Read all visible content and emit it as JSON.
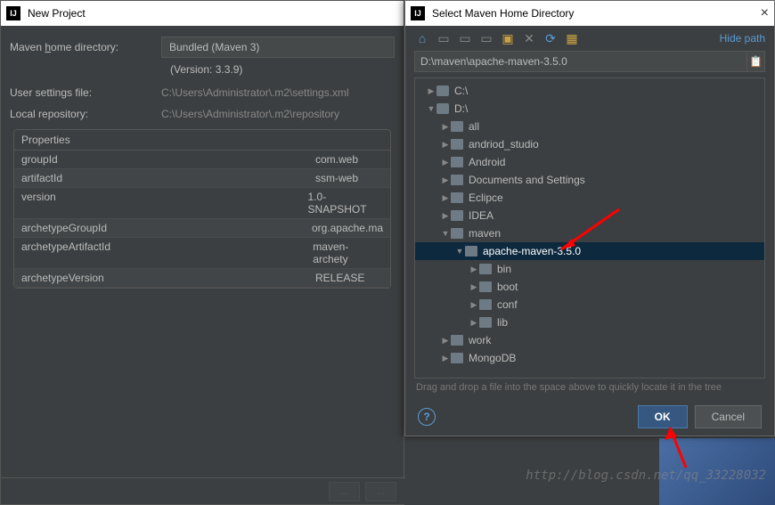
{
  "left": {
    "title": "New Project",
    "maven_home_label_pre": "Maven ",
    "maven_home_label_u": "h",
    "maven_home_label_post": "ome directory:",
    "maven_home_value": "Bundled (Maven 3)",
    "version_text": "(Version: 3.3.9)",
    "user_settings_label": "User settings file:",
    "user_settings_value": "C:\\Users\\Administrator\\.m2\\settings.xml",
    "local_repo_label": "Local repository:",
    "local_repo_value": "C:\\Users\\Administrator\\.m2\\repository",
    "properties_header": "Properties",
    "properties": [
      {
        "key": "groupId",
        "value": "com.web"
      },
      {
        "key": "artifactId",
        "value": "ssm-web"
      },
      {
        "key": "version",
        "value": "1.0-SNAPSHOT"
      },
      {
        "key": "archetypeGroupId",
        "value": "org.apache.ma"
      },
      {
        "key": "archetypeArtifactId",
        "value": "maven-archety"
      },
      {
        "key": "archetypeVersion",
        "value": "RELEASE"
      }
    ]
  },
  "right": {
    "title": "Select Maven Home Directory",
    "hide_path": "Hide path",
    "path_value": "D:\\maven\\apache-maven-3.5.0",
    "tree": [
      {
        "indent": 1,
        "arrow": "right",
        "icon": "disk",
        "label": "C:\\",
        "selected": false
      },
      {
        "indent": 1,
        "arrow": "down",
        "icon": "disk",
        "label": "D:\\",
        "selected": false
      },
      {
        "indent": 2,
        "arrow": "right",
        "icon": "folder",
        "label": "all",
        "selected": false
      },
      {
        "indent": 2,
        "arrow": "right",
        "icon": "folder",
        "label": "andriod_studio",
        "selected": false
      },
      {
        "indent": 2,
        "arrow": "right",
        "icon": "folder",
        "label": "Android",
        "selected": false
      },
      {
        "indent": 2,
        "arrow": "right",
        "icon": "folder",
        "label": "Documents and Settings",
        "selected": false
      },
      {
        "indent": 2,
        "arrow": "right",
        "icon": "folder",
        "label": "Eclipce",
        "selected": false
      },
      {
        "indent": 2,
        "arrow": "right",
        "icon": "folder",
        "label": "IDEA",
        "selected": false
      },
      {
        "indent": 2,
        "arrow": "down",
        "icon": "folder",
        "label": "maven",
        "selected": false
      },
      {
        "indent": 3,
        "arrow": "down",
        "icon": "folder",
        "label": "apache-maven-3.5.0",
        "selected": true
      },
      {
        "indent": 4,
        "arrow": "right",
        "icon": "folder",
        "label": "bin",
        "selected": false
      },
      {
        "indent": 4,
        "arrow": "right",
        "icon": "folder",
        "label": "boot",
        "selected": false
      },
      {
        "indent": 4,
        "arrow": "right",
        "icon": "folder",
        "label": "conf",
        "selected": false
      },
      {
        "indent": 4,
        "arrow": "right",
        "icon": "folder",
        "label": "lib",
        "selected": false
      },
      {
        "indent": 2,
        "arrow": "right",
        "icon": "folder",
        "label": "work",
        "selected": false
      },
      {
        "indent": 2,
        "arrow": "right",
        "icon": "folder",
        "label": "MongoDB",
        "selected": false
      }
    ],
    "tree_hint": "Drag and drop a file into the space above to quickly locate it in the tree",
    "ok_label": "OK",
    "cancel_label": "Cancel"
  },
  "watermark": "http://blog.csdn.net/qq_33228032"
}
